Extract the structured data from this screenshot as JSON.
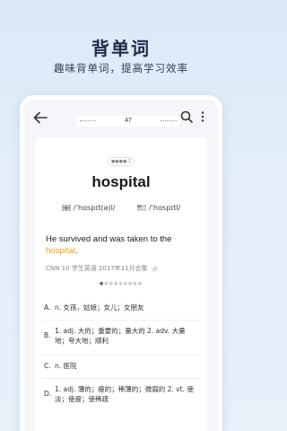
{
  "promo": {
    "title": "背单词",
    "subtitle": "趣味背单词，提高学习效率"
  },
  "topbar": {
    "back_icon": "back-arrow-icon",
    "progress": "47",
    "search_icon": "search-icon",
    "more_icon": "more-vertical-icon"
  },
  "card": {
    "rating": "●●●● 1",
    "word": "hospital",
    "phonetic_uk": "/ˈhɒspɪt(ə)l/",
    "phonetic_us": "/ˈhɑspɪtl/",
    "sentence_before": "He survived and was taken to the ",
    "sentence_highlight": "hospital",
    "sentence_after": ".",
    "source": "CNN 10 学生英语 2017年11月合集"
  },
  "options": [
    {
      "letter": "A.",
      "text": "n. 女孩，姑娘；女儿；女朋友"
    },
    {
      "letter": "B.",
      "text": "1. adj. 大的；重要的；量大的 2. adv. 大量地；夸大地；顺利"
    },
    {
      "letter": "C.",
      "text": "n. 医院"
    },
    {
      "letter": "D.",
      "text": "1. adj. 薄的；瘦的；稀薄的；微弱的 2. vt. 使淡；使瘦；使稀疏"
    }
  ],
  "colors": {
    "highlight": "#f0a318",
    "background": "#dbe9f7",
    "title": "#1f2d4a"
  }
}
